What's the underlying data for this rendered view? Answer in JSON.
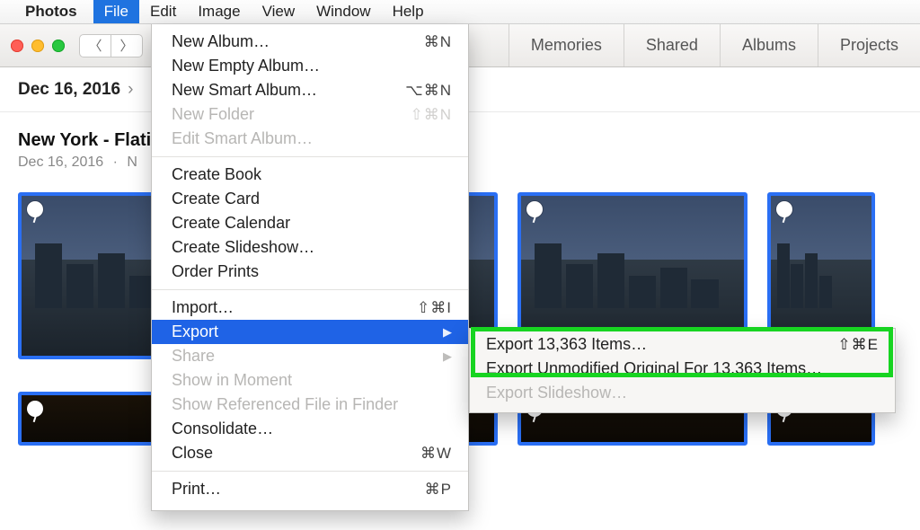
{
  "menubar": {
    "app": "Photos",
    "items": [
      "File",
      "Edit",
      "Image",
      "View",
      "Window",
      "Help"
    ],
    "active": "File"
  },
  "toolbar": {
    "tabs": [
      "Memories",
      "Shared",
      "Albums",
      "Projects"
    ]
  },
  "breadcrumb": {
    "date": "Dec 16, 2016"
  },
  "section": {
    "title": "New York - Flati",
    "date": "Dec 16, 2016",
    "place_initial": "N"
  },
  "file_menu": {
    "new_album": "New Album…",
    "new_album_key": "⌘N",
    "new_empty_album": "New Empty Album…",
    "new_smart_album": "New Smart Album…",
    "new_smart_album_key": "⌥⌘N",
    "new_folder": "New Folder",
    "new_folder_key": "⇧⌘N",
    "edit_smart_album": "Edit Smart Album…",
    "create_book": "Create Book",
    "create_card": "Create Card",
    "create_calendar": "Create Calendar",
    "create_slideshow": "Create Slideshow…",
    "order_prints": "Order Prints",
    "import": "Import…",
    "import_key": "⇧⌘I",
    "export": "Export",
    "share": "Share",
    "show_in_moment": "Show in Moment",
    "show_referenced": "Show Referenced File in Finder",
    "consolidate": "Consolidate…",
    "close": "Close",
    "close_key": "⌘W",
    "print": "Print…",
    "print_key": "⌘P"
  },
  "export_submenu": {
    "export_items": "Export 13,363 Items…",
    "export_items_key": "⇧⌘E",
    "export_unmodified": "Export Unmodified Original For 13,363 Items…",
    "export_slideshow": "Export Slideshow…"
  }
}
